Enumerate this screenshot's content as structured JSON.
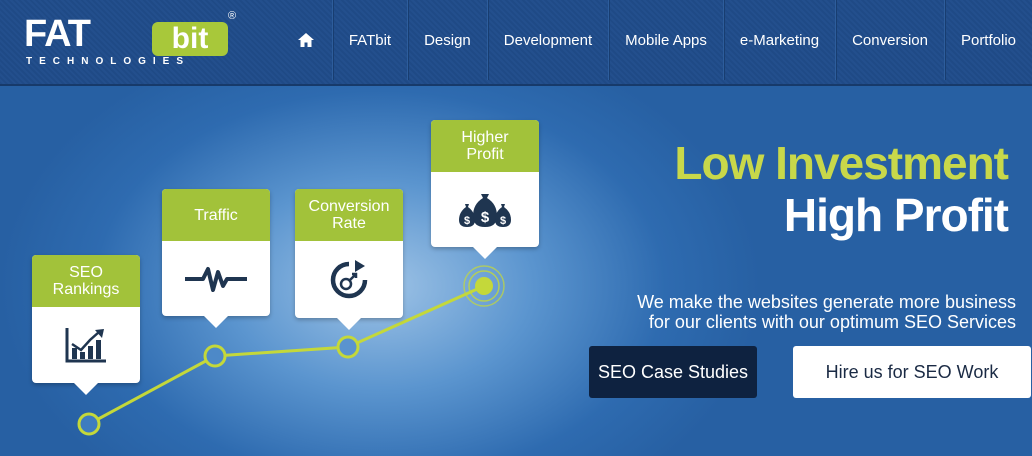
{
  "logo": {
    "fat": "FAT",
    "bit": "bit",
    "reg": "®",
    "tech": "TECHNOLOGIES"
  },
  "nav": {
    "home_icon": "home-icon",
    "items": [
      "FATbit",
      "Design",
      "Development",
      "Mobile Apps",
      "e-Marketing",
      "Conversion",
      "Portfolio"
    ]
  },
  "hero": {
    "cards": [
      {
        "title": "SEO Rankings",
        "icon": "bar-chart-icon"
      },
      {
        "title": "Traffic",
        "icon": "pulse-icon"
      },
      {
        "title": "Conversion Rate",
        "icon": "conversion-cycle-icon"
      },
      {
        "title": "Higher Profit",
        "icon": "money-bags-icon"
      }
    ],
    "headline_line1": "Low Investment",
    "headline_line2": "High Profit",
    "subtext_line1": "We make the websites generate more business",
    "subtext_line2": "for our clients with our optimum SEO Services",
    "btn_case_studies": "SEO Case Studies",
    "btn_hire": "Hire us for SEO Work"
  },
  "colors": {
    "accent_green": "#a2c23a",
    "headline_green": "#c8d84a",
    "header_blue": "#1f4a86",
    "dark_button": "#0e2240"
  }
}
